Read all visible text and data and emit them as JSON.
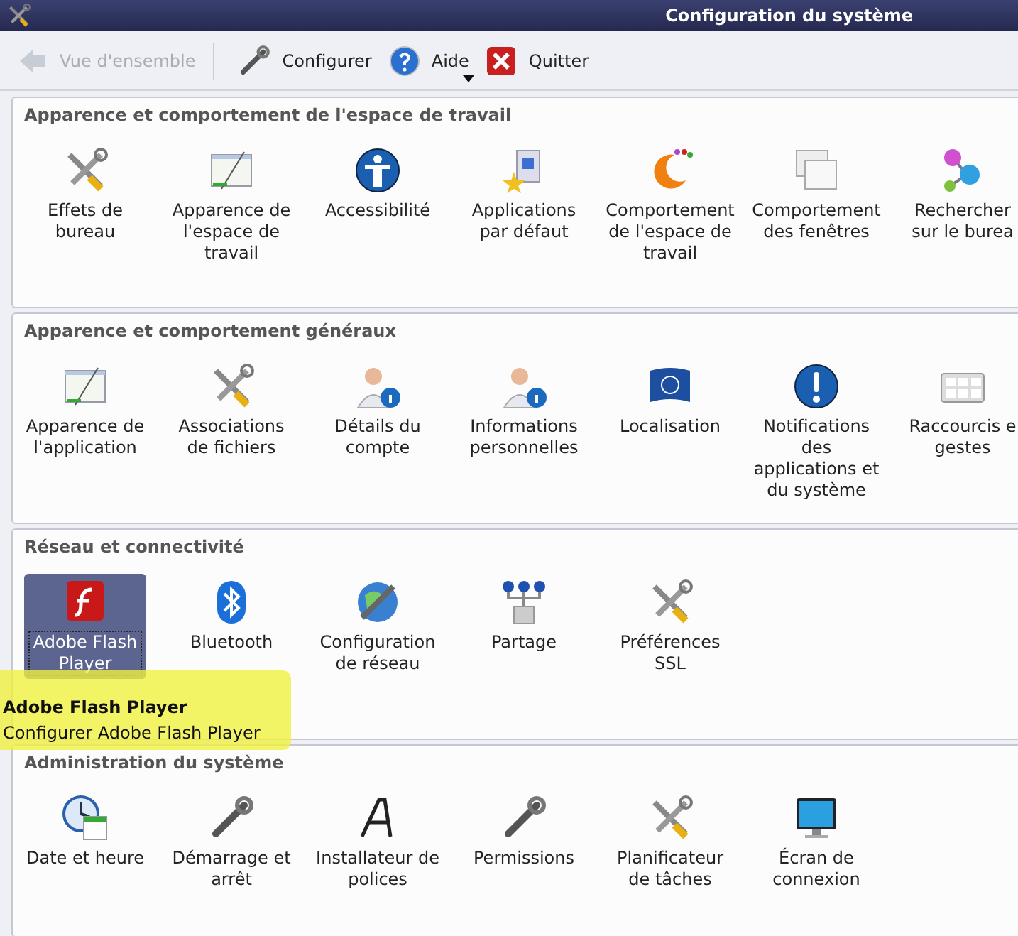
{
  "window": {
    "title": "Configuration du système"
  },
  "toolbar": [
    {
      "label": "Vue d'ensemble",
      "disabled": true,
      "menu": false
    },
    {
      "label": "Configurer",
      "disabled": false,
      "menu": false
    },
    {
      "label": "Aide",
      "disabled": false,
      "menu": true
    },
    {
      "label": "Quitter",
      "disabled": false,
      "menu": false
    }
  ],
  "sections": [
    {
      "title": "Apparence et comportement de l'espace de travail",
      "items": [
        {
          "label": "Effets de\nbureau",
          "selected": false
        },
        {
          "label": "Apparence de\nl'espace de\ntravail",
          "selected": false
        },
        {
          "label": "Accessibilité",
          "selected": false
        },
        {
          "label": "Applications\npar défaut",
          "selected": false
        },
        {
          "label": "Comportement\nde l'espace de\ntravail",
          "selected": false
        },
        {
          "label": "Comportement\ndes fenêtres",
          "selected": false
        },
        {
          "label": "Rechercher\nsur le burea",
          "selected": false
        }
      ]
    },
    {
      "title": "Apparence et comportement généraux",
      "items": [
        {
          "label": "Apparence de\nl'application",
          "selected": false
        },
        {
          "label": "Associations\nde fichiers",
          "selected": false
        },
        {
          "label": "Détails du\ncompte",
          "selected": false
        },
        {
          "label": "Informations\npersonnelles",
          "selected": false
        },
        {
          "label": "Localisation",
          "selected": false
        },
        {
          "label": "Notifications\ndes\napplications et\ndu système",
          "selected": false
        },
        {
          "label": "Raccourcis e\ngestes",
          "selected": false
        }
      ]
    },
    {
      "title": "Réseau et connectivité",
      "items": [
        {
          "label": "Adobe Flash\nPlayer",
          "selected": true
        },
        {
          "label": "Bluetooth",
          "selected": false
        },
        {
          "label": "Configuration\nde réseau",
          "selected": false
        },
        {
          "label": "Partage",
          "selected": false
        },
        {
          "label": "Préférences\nSSL",
          "selected": false
        }
      ]
    },
    {
      "title": "Administration du système",
      "items": [
        {
          "label": "Date et heure",
          "selected": false
        },
        {
          "label": "Démarrage et\narrêt",
          "selected": false
        },
        {
          "label": "Installateur de\npolices",
          "selected": false
        },
        {
          "label": "Permissions",
          "selected": false
        },
        {
          "label": "Planificateur\nde tâches",
          "selected": false
        },
        {
          "label": "Écran de\nconnexion",
          "selected": false
        }
      ]
    }
  ],
  "tooltip": {
    "title": "Adobe Flash Player",
    "text": "Configurer Adobe Flash Player"
  }
}
